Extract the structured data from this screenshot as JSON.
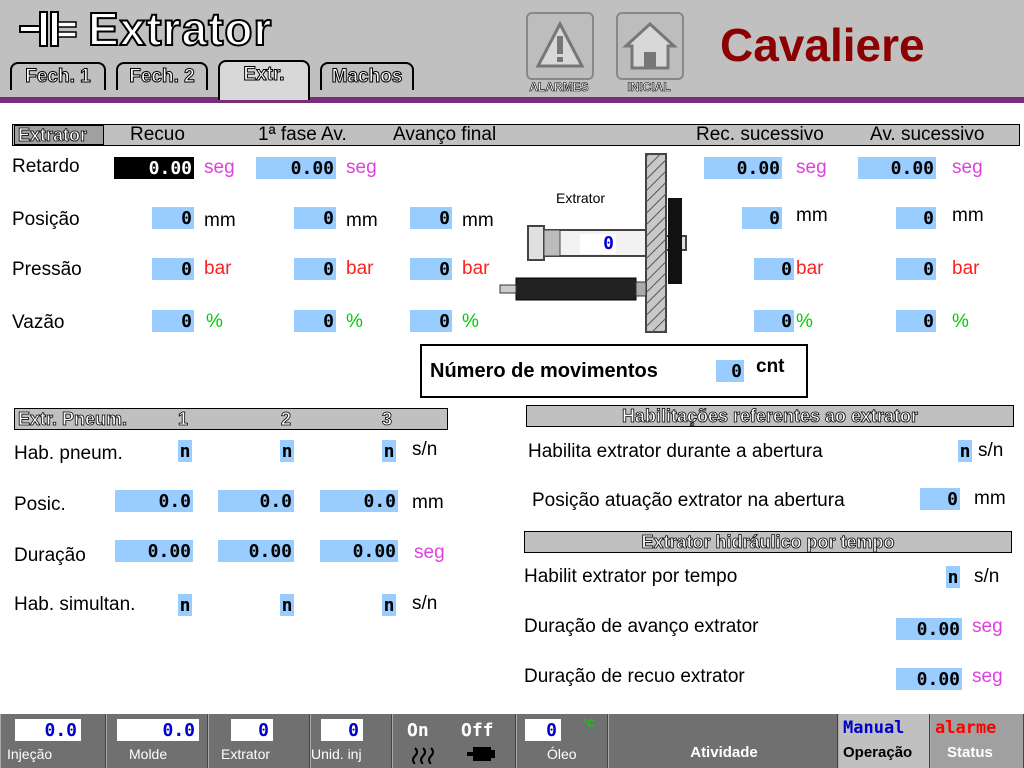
{
  "header": {
    "title": "Extrator",
    "brand": "Cavaliere",
    "tabs": [
      "Fech. 1",
      "Fech. 2",
      "Extr.",
      "Machos"
    ],
    "alarm_label": "ALARMES",
    "home_label": "INICIAL"
  },
  "extrator": {
    "section_label": "Extrator",
    "cols": [
      "Recuo",
      "1ª fase Av.",
      "Avanço final",
      "Rec. sucessivo",
      "Av. sucessivo"
    ],
    "rows": {
      "retardo": {
        "label": "Retardo",
        "recuo": "0.00",
        "fase1": "0.00",
        "rec_suc": "0.00",
        "av_suc": "0.00",
        "unit": "seg"
      },
      "posicao": {
        "label": "Posição",
        "recuo": "0",
        "fase1": "0",
        "final": "0",
        "rec_suc": "0",
        "av_suc": "0",
        "unit": "mm"
      },
      "pressao": {
        "label": "Pressão",
        "recuo": "0",
        "fase1": "0",
        "final": "0",
        "rec_suc": "0",
        "av_suc": "0",
        "unit": "bar"
      },
      "vazao": {
        "label": "Vazão",
        "recuo": "0",
        "fase1": "0",
        "final": "0",
        "rec_suc": "0",
        "av_suc": "0",
        "unit": "%"
      }
    },
    "diagram_label": "Extrator",
    "diagram_value": "0",
    "movimentos": {
      "label": "Número de movimentos",
      "value": "0",
      "unit": "cnt"
    }
  },
  "pneum": {
    "section_label": "Extr. Pneum.",
    "cols": [
      "1",
      "2",
      "3"
    ],
    "hab": {
      "label": "Hab. pneum.",
      "values": [
        "n",
        "n",
        "n"
      ],
      "unit": "s/n"
    },
    "posic": {
      "label": "Posic.",
      "values": [
        "0.0",
        "0.0",
        "0.0"
      ],
      "unit": "mm"
    },
    "duracao": {
      "label": "Duração",
      "values": [
        "0.00",
        "0.00",
        "0.00"
      ],
      "unit": "seg"
    },
    "simultan": {
      "label": "Hab. simultan.",
      "values": [
        "n",
        "n",
        "n"
      ],
      "unit": "s/n"
    }
  },
  "habilitacoes": {
    "title": "Habilitações referentes ao extrator",
    "hab_abertura": {
      "label": "Habilita extrator durante a abertura",
      "value": "n",
      "unit": "s/n"
    },
    "pos_abertura": {
      "label": "Posição atuação extrator na abertura",
      "value": "0",
      "unit": "mm"
    }
  },
  "hidraulico": {
    "title": "Extrator hidráulico por tempo",
    "hab_tempo": {
      "label": "Habilit extrator por tempo",
      "value": "n",
      "unit": "s/n"
    },
    "dur_avanco": {
      "label": "Duração de avanço extrator",
      "value": "0.00",
      "unit": "seg"
    },
    "dur_recuo": {
      "label": "Duração de recuo extrator",
      "value": "0.00",
      "unit": "seg"
    }
  },
  "footer": {
    "injecao": {
      "label": "Injeção",
      "value": "0.0"
    },
    "molde": {
      "label": "Molde",
      "value": "0.0"
    },
    "extrator": {
      "label": "Extrator",
      "value": "0"
    },
    "unid_inj": {
      "label": "Unid. inj",
      "value": "0"
    },
    "on": "On",
    "off": "Off",
    "oleo": {
      "label": "Óleo",
      "value": "0",
      "unit": "°C"
    },
    "atividade": "Atividade",
    "operacao": {
      "mode": "Manual",
      "label": "Operação"
    },
    "status": {
      "state": "alarme",
      "label": "Status"
    }
  },
  "colors": {
    "accent": "#7b2c7b",
    "brand": "#8b0000",
    "field": "#99ccff"
  }
}
